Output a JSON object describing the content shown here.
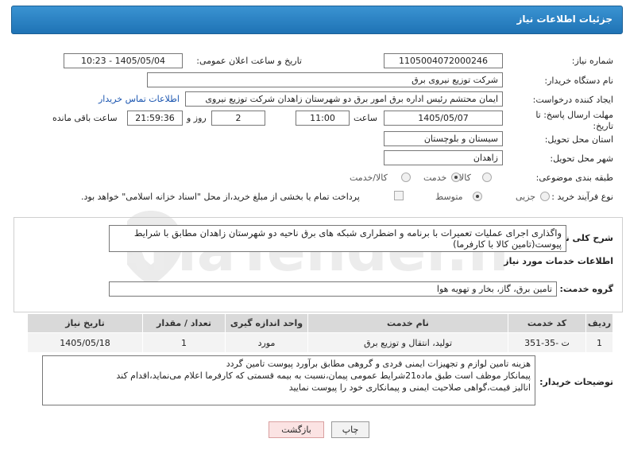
{
  "title": "جزئیات اطلاعات نیاز",
  "fields": {
    "need_number_label": "شماره نیاز:",
    "need_number": "1105004072000246",
    "announce_label": "تاریخ و ساعت اعلان عمومی:",
    "announce_value": "1405/05/04 - 10:23",
    "buyer_label": "نام دستگاه خریدار:",
    "buyer_value": "شرکت توزیع نیروی برق",
    "creator_label": "ایجاد کننده درخواست:",
    "creator_value": "ایمان محتشم رئیس اداره برق امور برق دو شهرستان زاهدان شرکت توزیع نیروی",
    "contact_link": "اطلاعات تماس خریدار",
    "deadline_label": "مهلت ارسال پاسخ: تا تاریخ:",
    "deadline_date": "1405/05/07",
    "time_label": "ساعت",
    "deadline_time": "11:00",
    "days_value": "2",
    "days_label": "روز و",
    "remaining_time": "21:59:36",
    "remaining_label": "ساعت باقی مانده",
    "province_label": "استان محل تحویل:",
    "province_value": "سیستان و بلوچستان",
    "city_label": "شهر محل تحویل:",
    "city_value": "زاهدان",
    "category_label": "طبقه بندی موضوعی:",
    "category_options": [
      "کالا",
      "خدمت",
      "کالا/خدمت"
    ],
    "process_label": "نوع فرآیند خرید :",
    "process_options": [
      "جزیی",
      "متوسط"
    ],
    "payment_note": "پرداخت تمام یا بخشی از مبلغ خرید،از محل \"اسناد خزانه اسلامی\" خواهد بود."
  },
  "summary": {
    "label": "شرح کلی نیاز:",
    "text": "واگذاری اجرای عملیات تعمیرات با برنامه و اضطراری شبکه های برق ناحیه دو شهرستان زاهدان مطابق با شرایط پیوست(تامین کالا با کارفرما)"
  },
  "services": {
    "section_title": "اطلاعات خدمات مورد نیاز",
    "group_label": "گروه خدمت:",
    "group_value": "تامین برق، گاز، بخار و تهویه هوا",
    "headers": [
      "ردیف",
      "کد خدمت",
      "نام خدمت",
      "واحد اندازه گیری",
      "تعداد / مقدار",
      "تاریخ نیاز"
    ],
    "rows": [
      [
        "1",
        "ت -35-351",
        "تولید، انتقال و توزیع برق",
        "مورد",
        "1",
        "1405/05/18"
      ]
    ]
  },
  "buyer_notes": {
    "label": "توضیحات خریدار:",
    "lines": [
      "هزینه تامین لوازم و تجهیزات ایمنی فردی و گروهی مطابق برآورد پیوست تامین گردد",
      "پیمانکار موظف است طبق ماده21شرایط عمومی پیمان،نسبت به بیمه قسمتی که کارفرما اعلام می‌نماید،اقدام کند",
      "انالیز قیمت،گواهی صلاحیت ایمنی و پیمانکاری خود را پیوست نمایید"
    ]
  },
  "buttons": {
    "print": "چاپ",
    "back": "بازگشت"
  },
  "watermark": "AriaTender.neT",
  "colors": {
    "title_bar": "#2a84c6",
    "link": "#1a55b0",
    "watermark": "#e9e9e9"
  }
}
